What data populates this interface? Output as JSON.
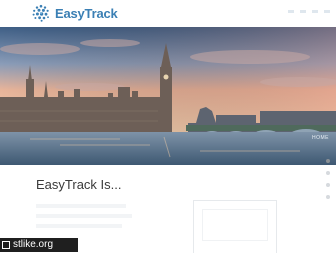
{
  "brand": {
    "name": "EasyTrack",
    "color": "#3a7fb4"
  },
  "hero": {
    "caption": "HOME"
  },
  "carousel": {
    "slides": 4,
    "active_index": 0
  },
  "section": {
    "title": "EasyTrack Is..."
  },
  "watermark": {
    "text": "stlike.org"
  }
}
